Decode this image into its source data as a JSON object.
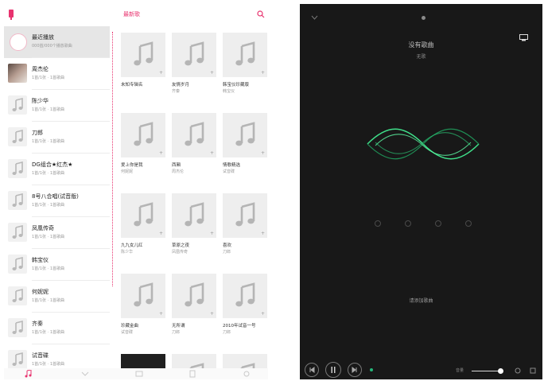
{
  "colors": {
    "accent": "#e8336f",
    "player_bg": "#181818",
    "wave_green": "#3fe08a"
  },
  "left": {
    "top_title": "最新歌",
    "sidebar": [
      {
        "name": "最近播放",
        "sub": "000首/000个播放歌曲",
        "selected": true,
        "thumb": "clock"
      },
      {
        "name": "周杰伦",
        "sub": "1首/1张 · 1首歌曲",
        "thumb": "photo"
      },
      {
        "name": "陈少华",
        "sub": "1首/1张 · 1首歌曲",
        "thumb": "note"
      },
      {
        "name": "刀郎",
        "sub": "1首/1张 · 1首歌曲",
        "thumb": "note"
      },
      {
        "name": "DG组合★红杰★",
        "sub": "1首/1张 · 1首歌曲",
        "thumb": "note"
      },
      {
        "name": "8号八合唱(试音版)",
        "sub": "1首/1张 · 1首歌曲",
        "thumb": "note"
      },
      {
        "name": "凤凰传奇",
        "sub": "1首/1张 · 1首歌曲",
        "thumb": "note"
      },
      {
        "name": "韩宝仪",
        "sub": "1首/1张 · 1首歌曲",
        "thumb": "note"
      },
      {
        "name": "何妮妮",
        "sub": "1首/1张 · 1首歌曲",
        "thumb": "note"
      },
      {
        "name": "齐秦",
        "sub": "1首/1张 · 1首歌曲",
        "thumb": "note"
      },
      {
        "name": "试音碟",
        "sub": "1首/1张 · 1首歌曲",
        "thumb": "note"
      }
    ],
    "albums": [
      {
        "title": "未知专辑名",
        "sub": ""
      },
      {
        "title": "友情岁月",
        "sub": "齐秦"
      },
      {
        "title": "韩宝仪珍藏版",
        "sub": "韩宝仪"
      },
      {
        "title": "爱上你是我",
        "sub": "何妮妮"
      },
      {
        "title": "西厢",
        "sub": "周杰伦"
      },
      {
        "title": "情歌精选",
        "sub": "试音碟"
      },
      {
        "title": "九九女儿红",
        "sub": "陈少华"
      },
      {
        "title": "草原之夜",
        "sub": "凤凰传奇"
      },
      {
        "title": "喜欢",
        "sub": "刀郎"
      },
      {
        "title": "珍藏金曲",
        "sub": "试音碟"
      },
      {
        "title": "无所谓",
        "sub": "刀郎"
      },
      {
        "title": "2010年试音一号",
        "sub": "刀郎"
      },
      {
        "title": "",
        "sub": ""
      },
      {
        "title": "",
        "sub": ""
      },
      {
        "title": "",
        "sub": ""
      }
    ]
  },
  "right": {
    "title": "没有歌曲",
    "subtitle": "无歌",
    "message": "请添加歌曲",
    "volume_label": "音量",
    "volume_level": 0.9
  }
}
